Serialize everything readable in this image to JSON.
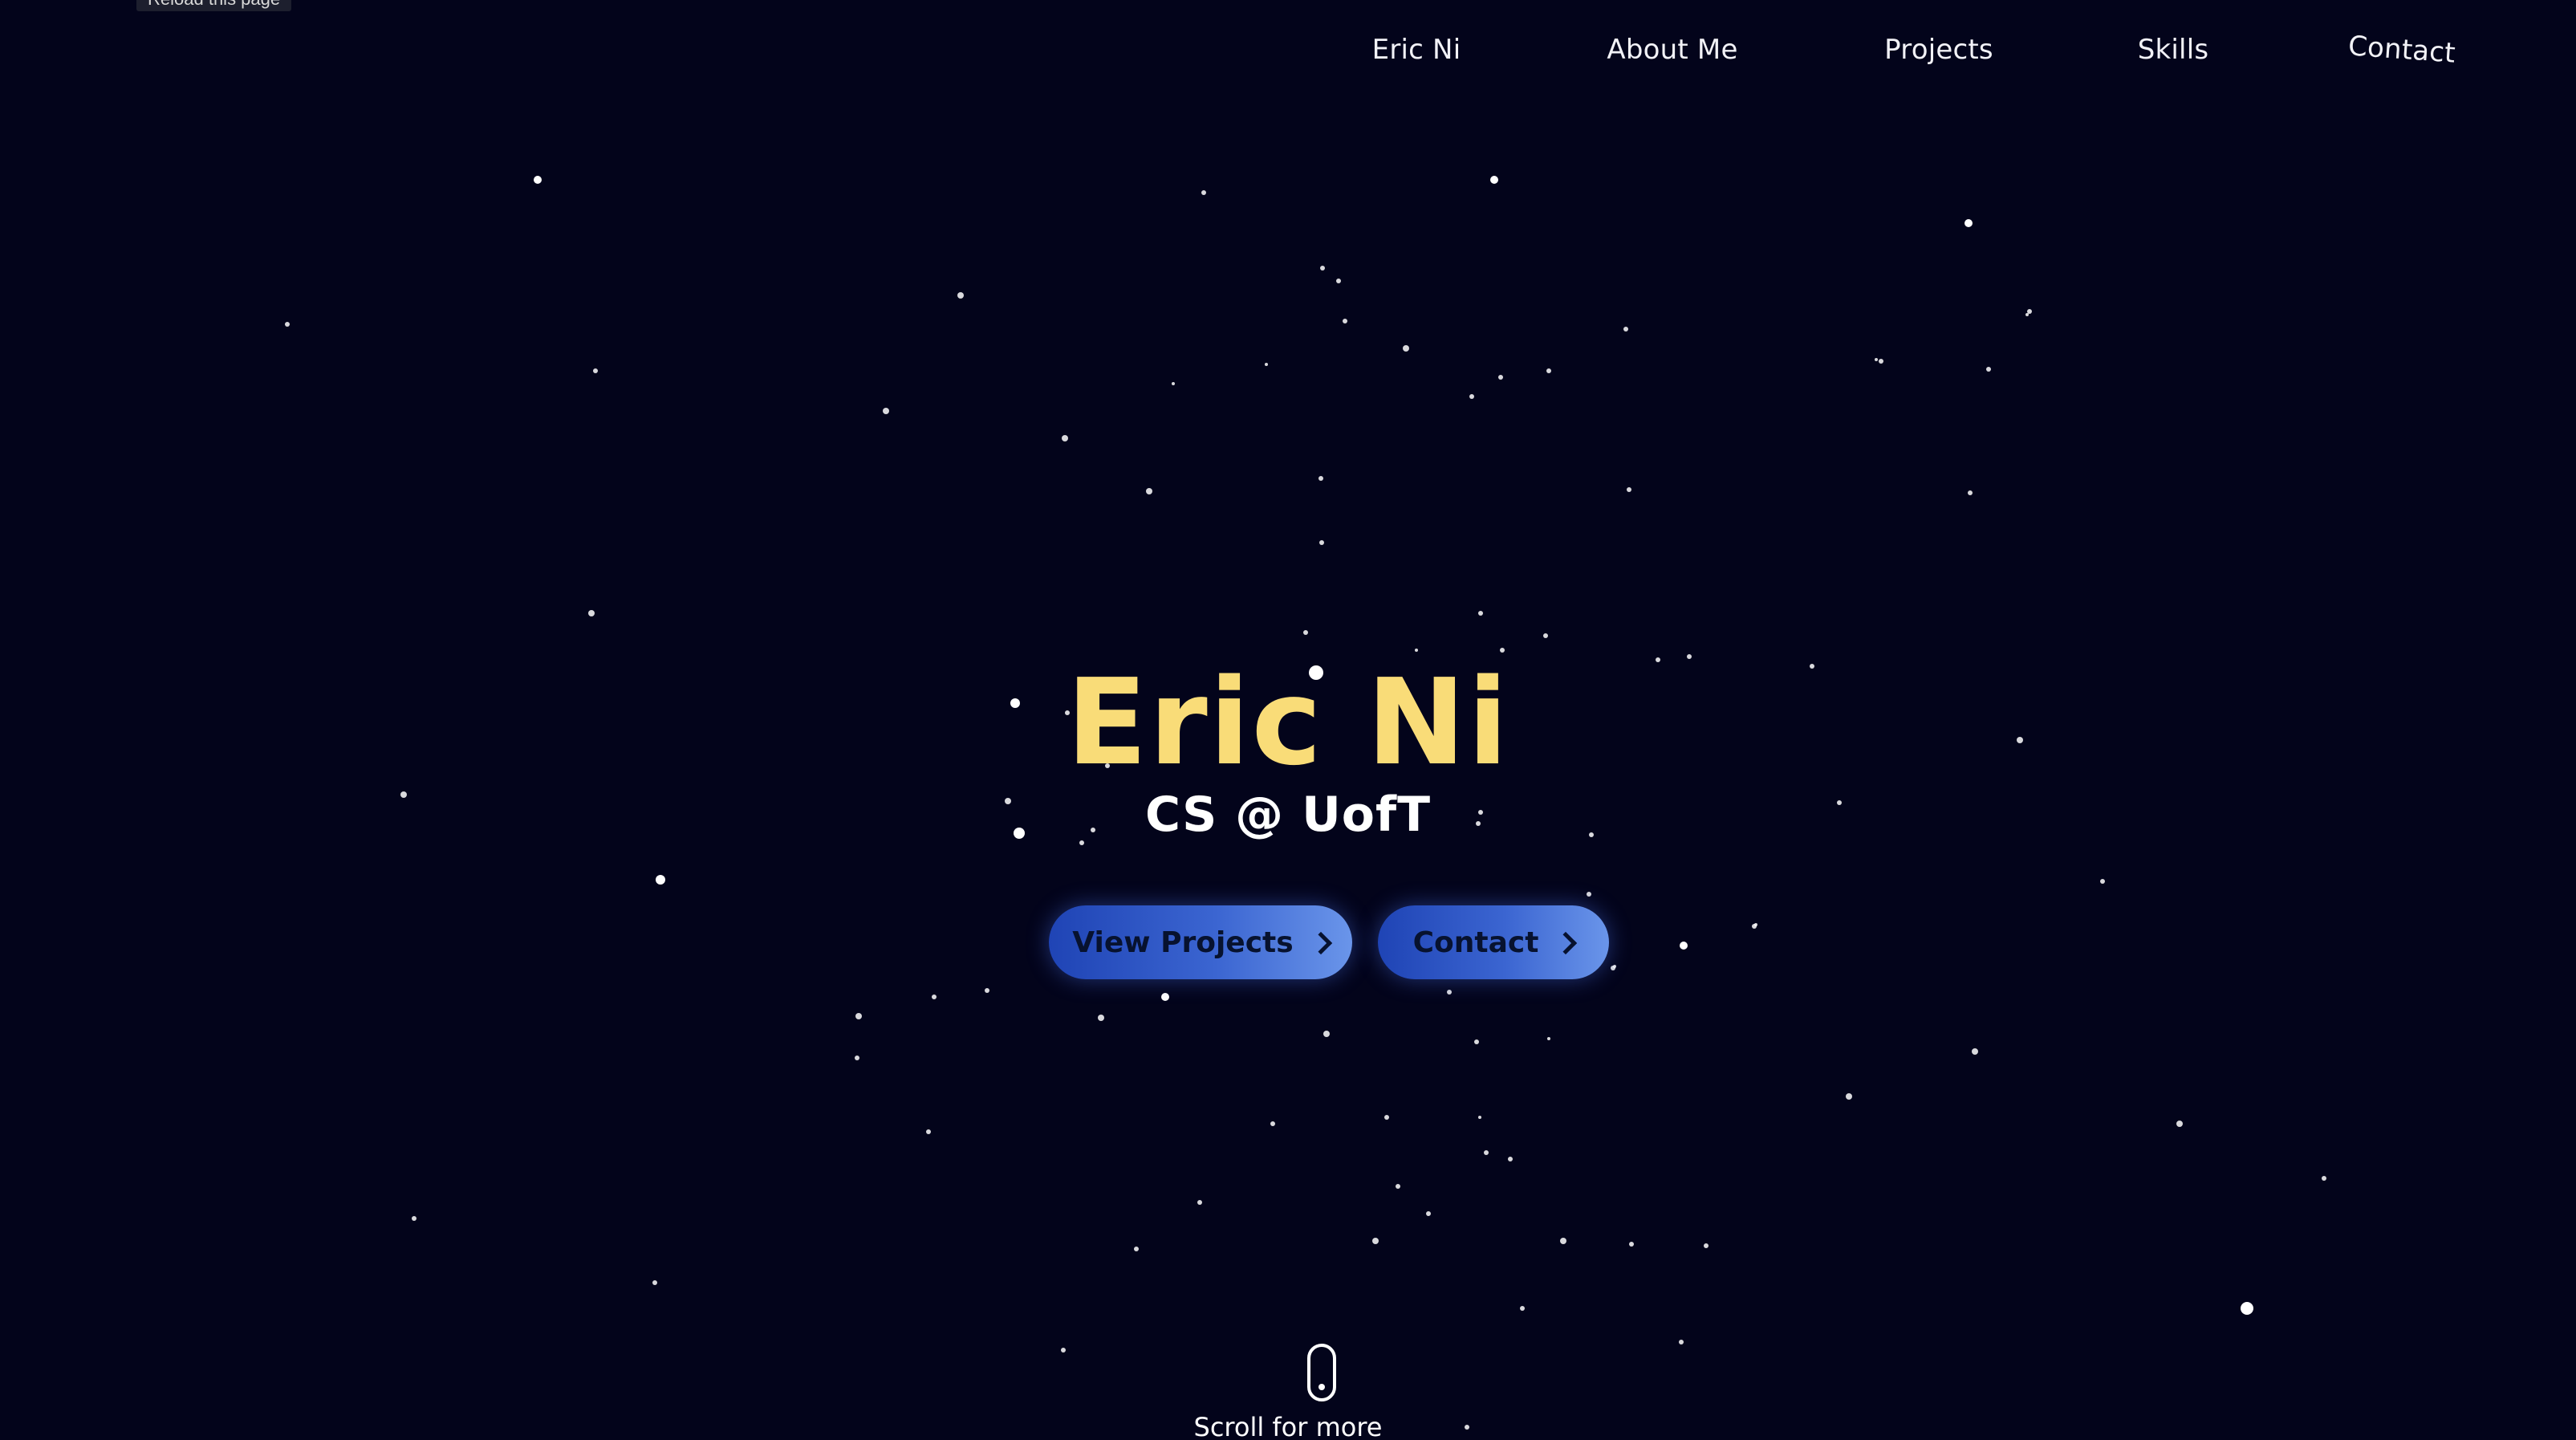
{
  "browser": {
    "tooltip": "Reload this page"
  },
  "nav": {
    "items": [
      {
        "label": "Eric Ni"
      },
      {
        "label": "About Me"
      },
      {
        "label": "Projects"
      },
      {
        "label": "Skills"
      },
      {
        "label": "Contact"
      }
    ]
  },
  "hero": {
    "title": "Eric Ni",
    "subtitle": "CS @ UofT",
    "buttons": [
      {
        "label": "View Projects",
        "icon": "chevron-right-icon"
      },
      {
        "label": "Contact",
        "icon": "chevron-right-icon"
      }
    ]
  },
  "scroll": {
    "label": "Scroll for more",
    "icon": "mouse-icon"
  },
  "colors": {
    "background": "#03041b",
    "title": "#f9dc78",
    "button_gradient_start": "#1f44b5",
    "button_gradient_end": "#6a95ea",
    "star": "#ffffff"
  }
}
